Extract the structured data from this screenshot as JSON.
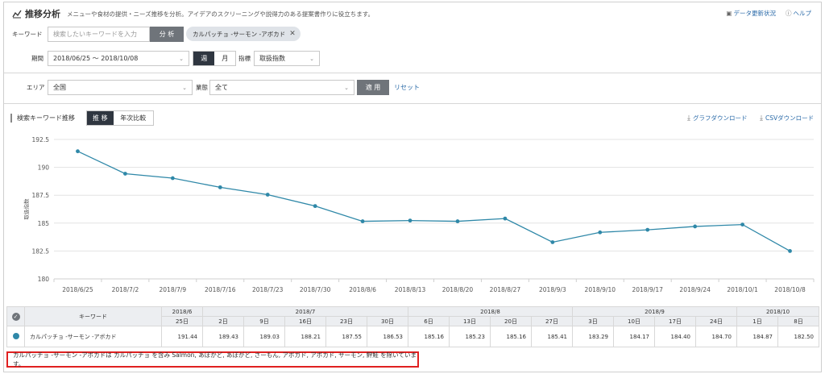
{
  "header": {
    "title": "推移分析",
    "description": "メニューや食材の提供・ニーズ推移を分析。アイデアのスクリーニングや説得力のある提案書作りに役立ちます。",
    "links": [
      {
        "icon": "data-update-icon",
        "label": "データ更新状況"
      },
      {
        "icon": "help-icon",
        "label": "ヘルプ"
      }
    ]
  },
  "filters": {
    "keyword_label": "キーワード",
    "keyword_placeholder": "検索したいキーワードを入力",
    "analyze_button": "分 析",
    "chip_label": "カルパッチョ -サーモン -アボカド",
    "period_label": "期間",
    "period_value": "2018/06/25 〜 2018/10/08",
    "week_label": "週",
    "month_label": "月",
    "index_label": "指標",
    "index_value": "取扱指数",
    "area_label": "エリア",
    "area_value": "全国",
    "industry_label": "業態",
    "industry_value": "全て",
    "apply_button": "適 用",
    "reset_link": "リセット"
  },
  "chart_section": {
    "title": "検索キーワード推移",
    "tab_trend": "推 移",
    "tab_yoy": "年次比較",
    "graph_download": "グラフダウンロード",
    "csv_download": "CSVダウンロード"
  },
  "chart_data": {
    "type": "line",
    "ylabel": "取扱指数",
    "ylim": [
      180,
      192.5
    ],
    "yticks": [
      "180",
      "182.5",
      "185",
      "187.5",
      "190",
      "192.5"
    ],
    "categories": [
      "2018/6/25",
      "2018/7/2",
      "2018/7/9",
      "2018/7/16",
      "2018/7/23",
      "2018/7/30",
      "2018/8/6",
      "2018/8/13",
      "2018/8/20",
      "2018/8/27",
      "2018/9/3",
      "2018/9/10",
      "2018/9/17",
      "2018/9/24",
      "2018/10/1",
      "2018/10/8"
    ],
    "series": [
      {
        "values": [
          191.44,
          189.43,
          189.03,
          188.21,
          187.55,
          186.53,
          185.16,
          185.23,
          185.16,
          185.41,
          183.29,
          184.17,
          184.4,
          184.7,
          184.87,
          182.5
        ],
        "color": "#2f88a8"
      }
    ],
    "grid": "horizontal"
  },
  "table": {
    "keyword_header": "キーワード",
    "months": [
      {
        "label": "2018/6",
        "span": 1
      },
      {
        "label": "2018/7",
        "span": 5
      },
      {
        "label": "2018/8",
        "span": 4
      },
      {
        "label": "2018/9",
        "span": 4
      },
      {
        "label": "2018/10",
        "span": 2
      }
    ],
    "days": [
      "25日",
      "2日",
      "9日",
      "16日",
      "23日",
      "30日",
      "6日",
      "13日",
      "20日",
      "27日",
      "3日",
      "10日",
      "17日",
      "24日",
      "1日",
      "8日"
    ],
    "row": {
      "keyword": "カルパッチョ -サーモン -アボカド",
      "values": [
        "191.44",
        "189.43",
        "189.03",
        "188.21",
        "187.55",
        "186.53",
        "185.16",
        "185.23",
        "185.16",
        "185.41",
        "183.29",
        "184.17",
        "184.40",
        "184.70",
        "184.87",
        "182.50"
      ],
      "color": "#2f88a8"
    }
  },
  "note": "カルパッチョ -サーモン -アボカドは カルパッチョ を含み Salmon, あぼかど, あぼがど, さーもん, アボガド, アボカド, サーモン, 鮃鮭 を除いています。"
}
